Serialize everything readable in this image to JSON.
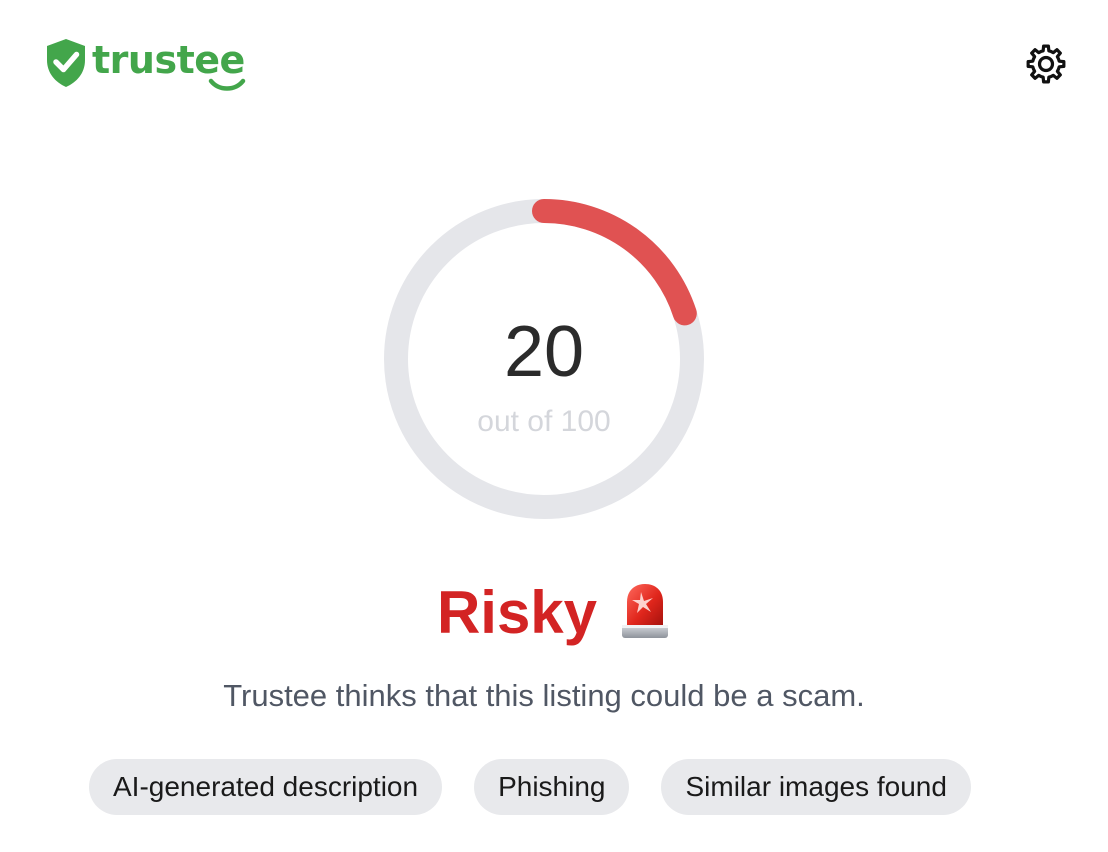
{
  "app": {
    "brand_name": "trustee",
    "brand_color": "#43a64b",
    "logo_icon": "shield-check-icon",
    "settings_icon": "gear-icon"
  },
  "score": {
    "value": "20",
    "subtitle": "out of 100",
    "fraction": 0.2,
    "track_color": "#e5e6ea",
    "progress_color": "#e05252"
  },
  "verdict": {
    "label": "Risky",
    "label_color": "#d32424",
    "icon": "siren-icon",
    "description": "Trustee thinks that this listing could be a scam."
  },
  "tags": [
    {
      "label": "AI-generated description"
    },
    {
      "label": "Phishing"
    },
    {
      "label": "Similar images found"
    }
  ]
}
